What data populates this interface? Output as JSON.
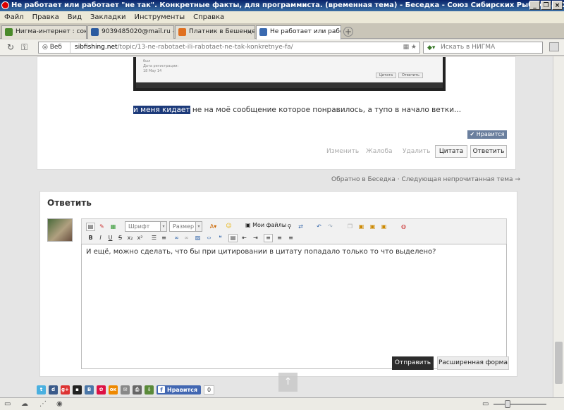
{
  "window": {
    "title": "Не работает или работает \"не так\". Конкретные факты, для программиста. (временная тема) - Беседка - Союз Сибирских Рыбаков - Opera",
    "buttons": [
      "_",
      "❐",
      "×"
    ]
  },
  "menu": [
    "Файл",
    "Правка",
    "Вид",
    "Закладки",
    "Инструменты",
    "Справка"
  ],
  "tabs": [
    {
      "label": "Нигма-интернет : союз ...",
      "color": "#4a8a2a"
    },
    {
      "label": "9039485020@mail.ru - П...",
      "color": "#2a5aa0"
    },
    {
      "label": "Платник в Бешенцево",
      "color": "#e07020"
    },
    {
      "label": "Не работает или работ...",
      "color": "#3a6ab0"
    }
  ],
  "address": {
    "web_label": "Веб",
    "domain": "sibfishing.net",
    "path": "/topic/13-ne-rabotaet-ili-rabotaet-ne-tak-konkretnye-fa/",
    "search_placeholder": "Искать в НИГМА"
  },
  "screenshot_lines": [
    "был",
    "Дата регистрации:",
    "18 May 14"
  ],
  "screenshot_buttons": [
    "Цитата",
    "Ответить"
  ],
  "post": {
    "selected": "и меня кидает",
    "rest": " не на моё сообщение которое понравилось, а тупо в начало ветки...",
    "like_badge": "✔ Нравится",
    "actions": {
      "edit": "Изменить",
      "report": "Жалоба",
      "delete": "Удалить",
      "quote": "Цитата",
      "reply": "Ответить"
    }
  },
  "thread_nav": "Обратно в Беседка · Следующая непрочитанная тема →",
  "reply": {
    "title": "Ответить",
    "font_select": "Шрифт",
    "size_select": "Размер",
    "my_files": "Мои файлы",
    "editor_text": "И ещё, можно сделать, что бы при цитировании в цитату попадало только то что выделено?",
    "send": "Отправить",
    "extended": "Расширенная форма"
  },
  "share": {
    "facebook_label": "Нравится",
    "facebook_count": "0"
  }
}
